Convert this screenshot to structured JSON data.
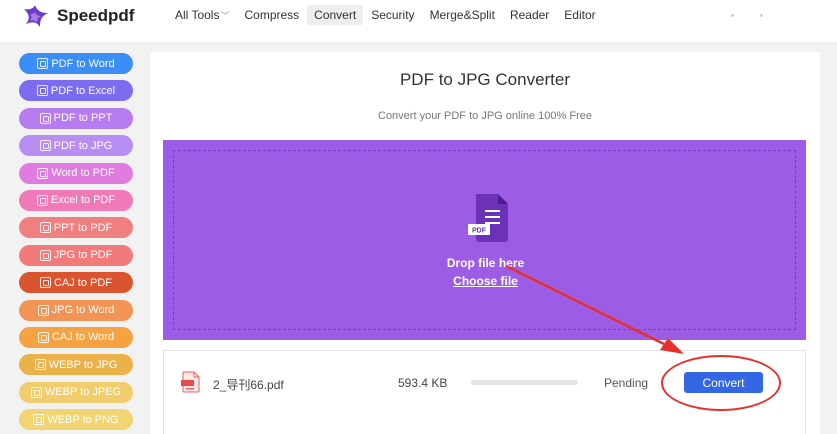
{
  "header": {
    "brand": "Speedpdf",
    "nav": [
      {
        "label": "All Tools",
        "has_caret": true
      },
      {
        "label": "Compress"
      },
      {
        "label": "Convert",
        "active": true
      },
      {
        "label": "Security"
      },
      {
        "label": "Merge&Split"
      },
      {
        "label": "Reader"
      },
      {
        "label": "Editor"
      }
    ],
    "caret_glyph": "﹀"
  },
  "sidebar": {
    "items": [
      {
        "label": "PDF to Word",
        "color": "#3a8ef5"
      },
      {
        "label": "PDF to Excel",
        "color": "#7b6cf0"
      },
      {
        "label": "PDF to PPT",
        "color": "#b67cf0"
      },
      {
        "label": "PDF to JPG",
        "color": "#b88ef2"
      },
      {
        "label": "Word to PDF",
        "color": "#e07be0"
      },
      {
        "label": "Excel to PDF",
        "color": "#f079b8"
      },
      {
        "label": "PPT to PDF",
        "color": "#f08080"
      },
      {
        "label": "JPG to PDF",
        "color": "#f27a7a"
      },
      {
        "label": "CAJ to PDF",
        "color": "#d9542f"
      },
      {
        "label": "JPG to Word",
        "color": "#f39457"
      },
      {
        "label": "CAJ to Word",
        "color": "#f5a243"
      },
      {
        "label": "WEBP to JPG",
        "color": "#ebb24a"
      },
      {
        "label": "WEBP to JPEG",
        "color": "#f2cd6e"
      },
      {
        "label": "WEBP to PNG",
        "color": "#f0d572"
      }
    ]
  },
  "main": {
    "title": "PDF to JPG Converter",
    "subtitle": "Convert your PDF to JPG online 100% Free",
    "dropzone": {
      "drop_text": "Drop file here",
      "choose_file": "Choose file",
      "icon_label": "PDF"
    },
    "file": {
      "name": "2_导刊66.pdf",
      "size": "593.4 KB",
      "progress": 0,
      "status": "Pending",
      "action": "Convert"
    }
  },
  "colors": {
    "accent": "#3467e3",
    "dropzone": "#9d5ce6",
    "annotation": "#e8302a"
  }
}
